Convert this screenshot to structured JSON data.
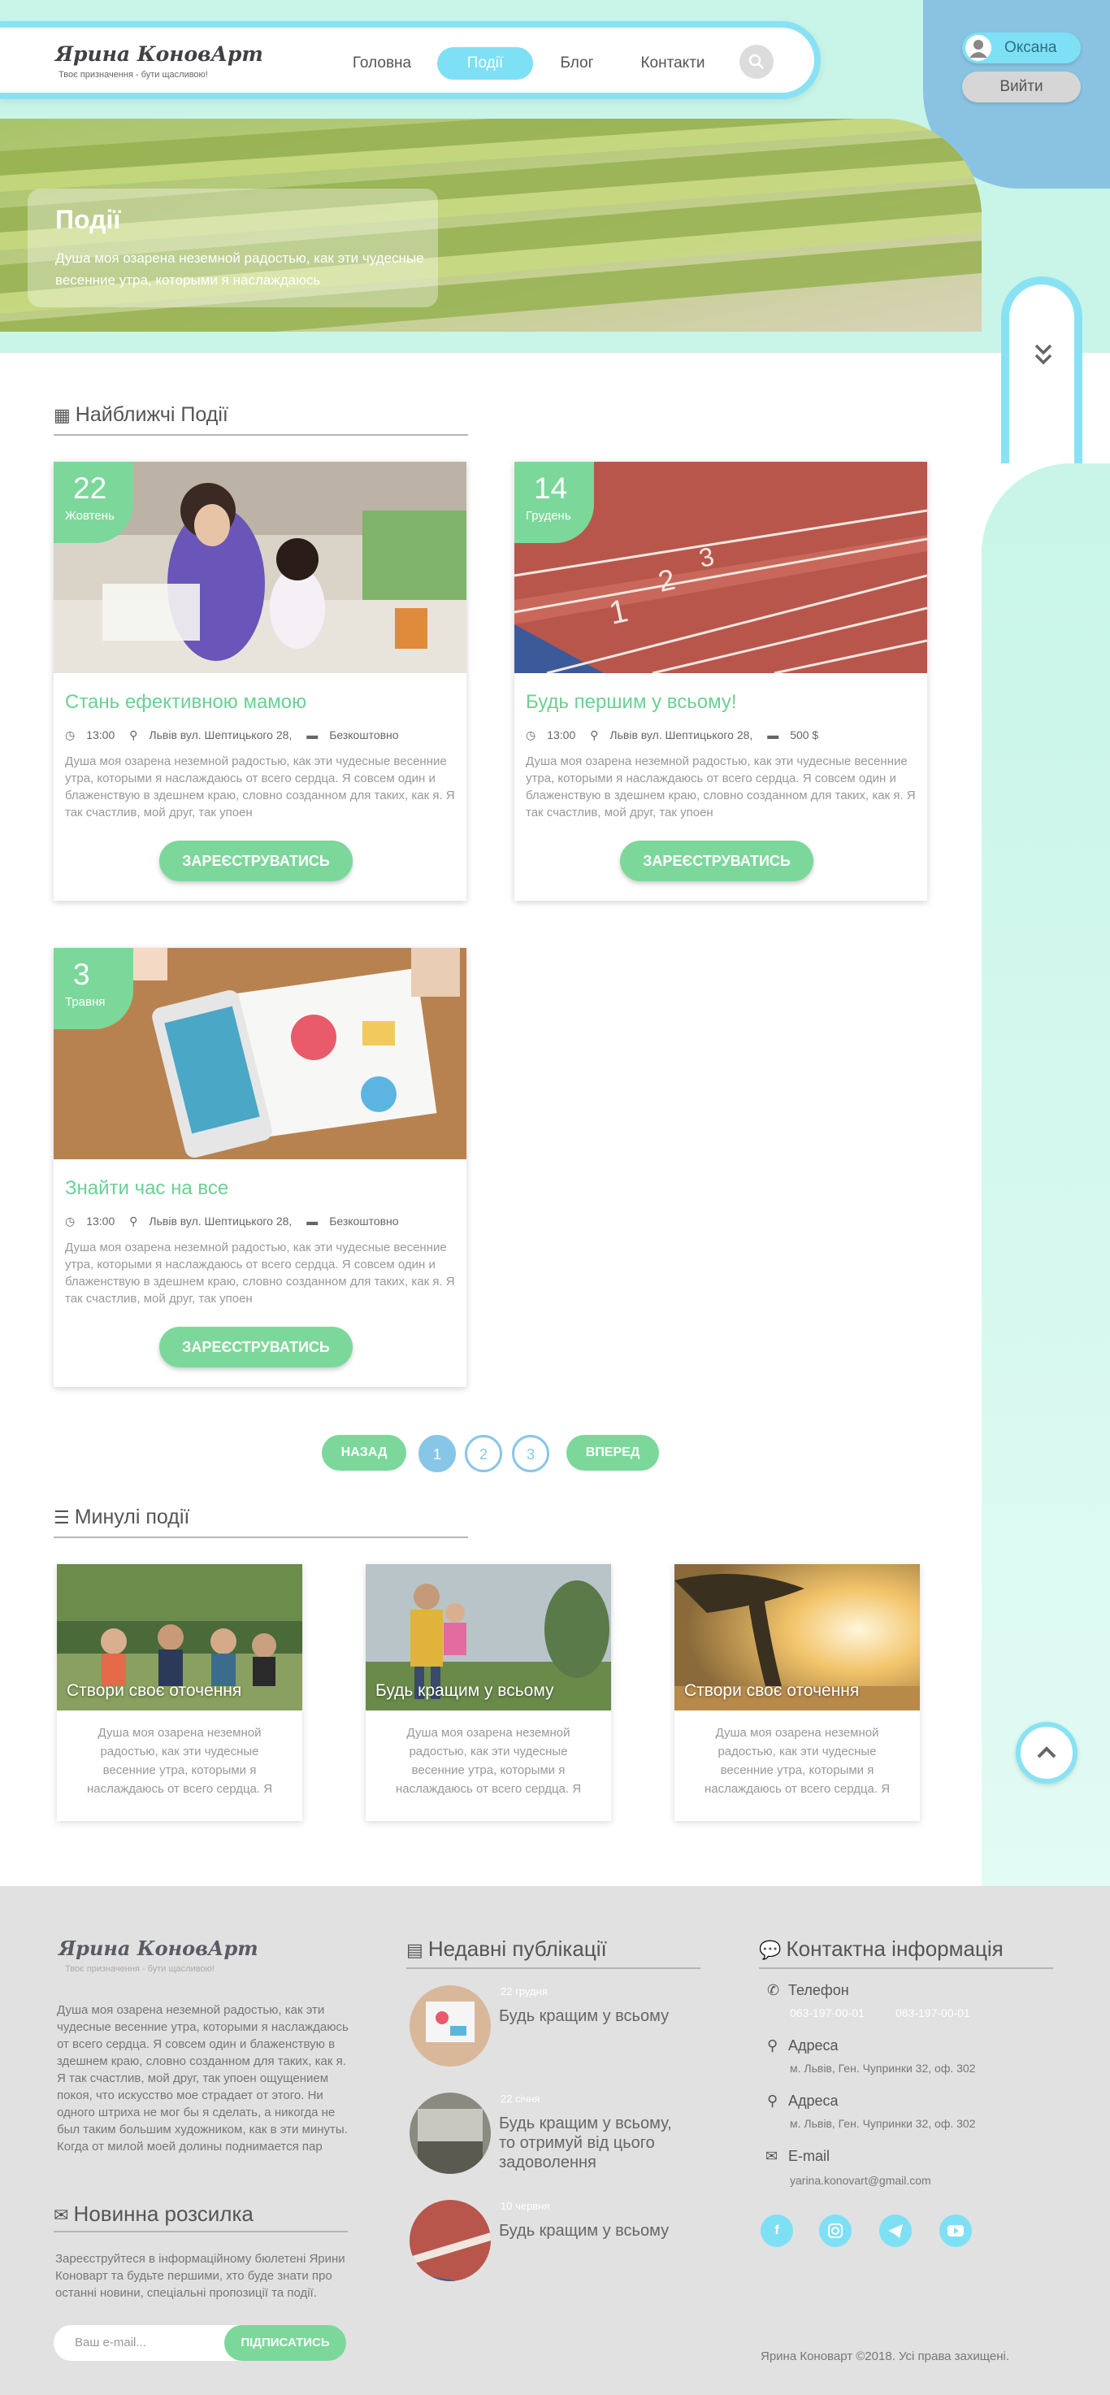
{
  "header": {
    "logo_title": "Ярина КоновАрт",
    "logo_tagline": "Твоє призначення - бути щасливою!",
    "nav": [
      {
        "label": "Головна"
      },
      {
        "label": "Події"
      },
      {
        "label": "Блог"
      },
      {
        "label": "Контакти"
      }
    ],
    "active_nav": "Події"
  },
  "user": {
    "name": "Оксана",
    "logout_label": "Вийти"
  },
  "hero": {
    "title": "Події",
    "text": "Душа моя озарена неземной радостью, как эти чудесные весенние утра, которыми я наслаждаюсь"
  },
  "upcoming": {
    "heading": "Найближчі Події",
    "events": [
      {
        "day": "22",
        "month": "Жовтень",
        "title": "Стань ефективною мамою",
        "time": "13:00",
        "place": "Львів вул. Шептицького 28,",
        "price": "Безкоштовно",
        "text": "Душа моя озарена неземной радостью, как эти чудесные весенние утра, которыми я наслаждаюсь от всего сердца. Я совсем один и блаженствую в здешнем краю, словно созданном для таких, как я. Я так счастлив, мой друг, так упоен",
        "button": "ЗАРЕЄСТРУВАТИСЬ"
      },
      {
        "day": "14",
        "month": "Грудень",
        "title": "Будь першим у всьому!",
        "time": "13:00",
        "place": "Львів вул. Шептицького 28,",
        "price": "500 $",
        "text": "Душа моя озарена неземной радостью, как эти чудесные весенние утра, которыми я наслаждаюсь от всего сердца. Я совсем один и блаженствую в здешнем краю, словно созданном для таких, как я. Я так счастлив, мой друг, так упоен",
        "button": "ЗАРЕЄСТРУВАТИСЬ"
      },
      {
        "day": "3",
        "month": "Травня",
        "title": "Знайти час на все",
        "time": "13:00",
        "place": "Львів вул. Шептицького 28,",
        "price": "Безкоштовно",
        "text": "Душа моя озарена неземной радостью, как эти чудесные весенние утра, которыми я наслаждаюсь от всего сердца. Я совсем один и блаженствую в здешнем краю, словно созданном для таких, как я. Я так счастлив, мой друг, так упоен",
        "button": "ЗАРЕЄСТРУВАТИСЬ"
      }
    ]
  },
  "pagination": {
    "prev": "НАЗАД",
    "pages": [
      "1",
      "2",
      "3"
    ],
    "current": "1",
    "next": "ВПЕРЕД"
  },
  "past": {
    "heading": "Минулі події",
    "events": [
      {
        "title": "Створи своє оточення",
        "text": "Душа моя озарена неземной радостью, как эти чудесные весенние утра, которыми я наслаждаюсь от всего сердца. Я"
      },
      {
        "title": "Будь кращим у всьому",
        "text": "Душа моя озарена неземной радостью, как эти чудесные весенние утра, которыми я наслаждаюсь от всего сердца. Я"
      },
      {
        "title": "Створи своє оточення",
        "text": "Душа моя озарена неземной радостью, как эти чудесные весенние утра, которыми я наслаждаюсь от всего сердца. Я"
      }
    ]
  },
  "footer": {
    "logo_title": "Ярина КоновАрт",
    "logo_tagline": "Твоє призначення - бути щасливою!",
    "about": "Душа моя озарена неземной радостью, как эти чудесные весенние утра, которыми я наслаждаюсь от всего сердца. Я совсем один и блаженствую в здешнем краю, словно созданном для таких, как я. Я так счастлив, мой друг, так упоен ощущением покоя, что искусство мое страдает от этого. Ни одного штриха не мог бы я сделать, а никогда не был таким большим художником, как в эти минуты. Когда от милой моей долины поднимается пар",
    "newsletter": {
      "heading": "Новинна розсилка",
      "text": "Зареєструйтеся в інформаційному бюлетені Ярини Коноварт та будьте першими, хто буде знати про останні новини, спеціальні пропозиції та події.",
      "placeholder": "Ваш e-mail...",
      "button": "ПІДПИСАТИСЬ"
    },
    "recent": {
      "heading": "Недавні публікації",
      "posts": [
        {
          "date": "22 грудня",
          "title": "Будь кращим у всьому"
        },
        {
          "date": "22 січня",
          "title": "Будь кращим у всьому, то отримуй від цього задоволення"
        },
        {
          "date": "10 червня",
          "title": "Будь кращим у всьому"
        }
      ]
    },
    "contact": {
      "heading": "Контактна інформація",
      "phone_label": "Телефон",
      "phones": [
        "063-197-00-01",
        "063-197-00-01"
      ],
      "address_label": "Адреса",
      "address1": "м. Львів, Ген. Чупринки 32, оф. 302",
      "address2": "м. Львів, Ген. Чупринки 32, оф. 302",
      "email_label": "E-mail",
      "email": "yarina.konovart@gmail.com",
      "social": [
        "f",
        "instagram",
        "telegram",
        "youtube"
      ]
    },
    "copyright": "Ярина Коноварт ©2018. Усі права захищені."
  },
  "colors": {
    "mint": "#c8f5e8",
    "cyan": "#7ee0f5",
    "green": "#7cd89a",
    "blue": "#8ac3e2",
    "footer": "#e1e1e1"
  }
}
